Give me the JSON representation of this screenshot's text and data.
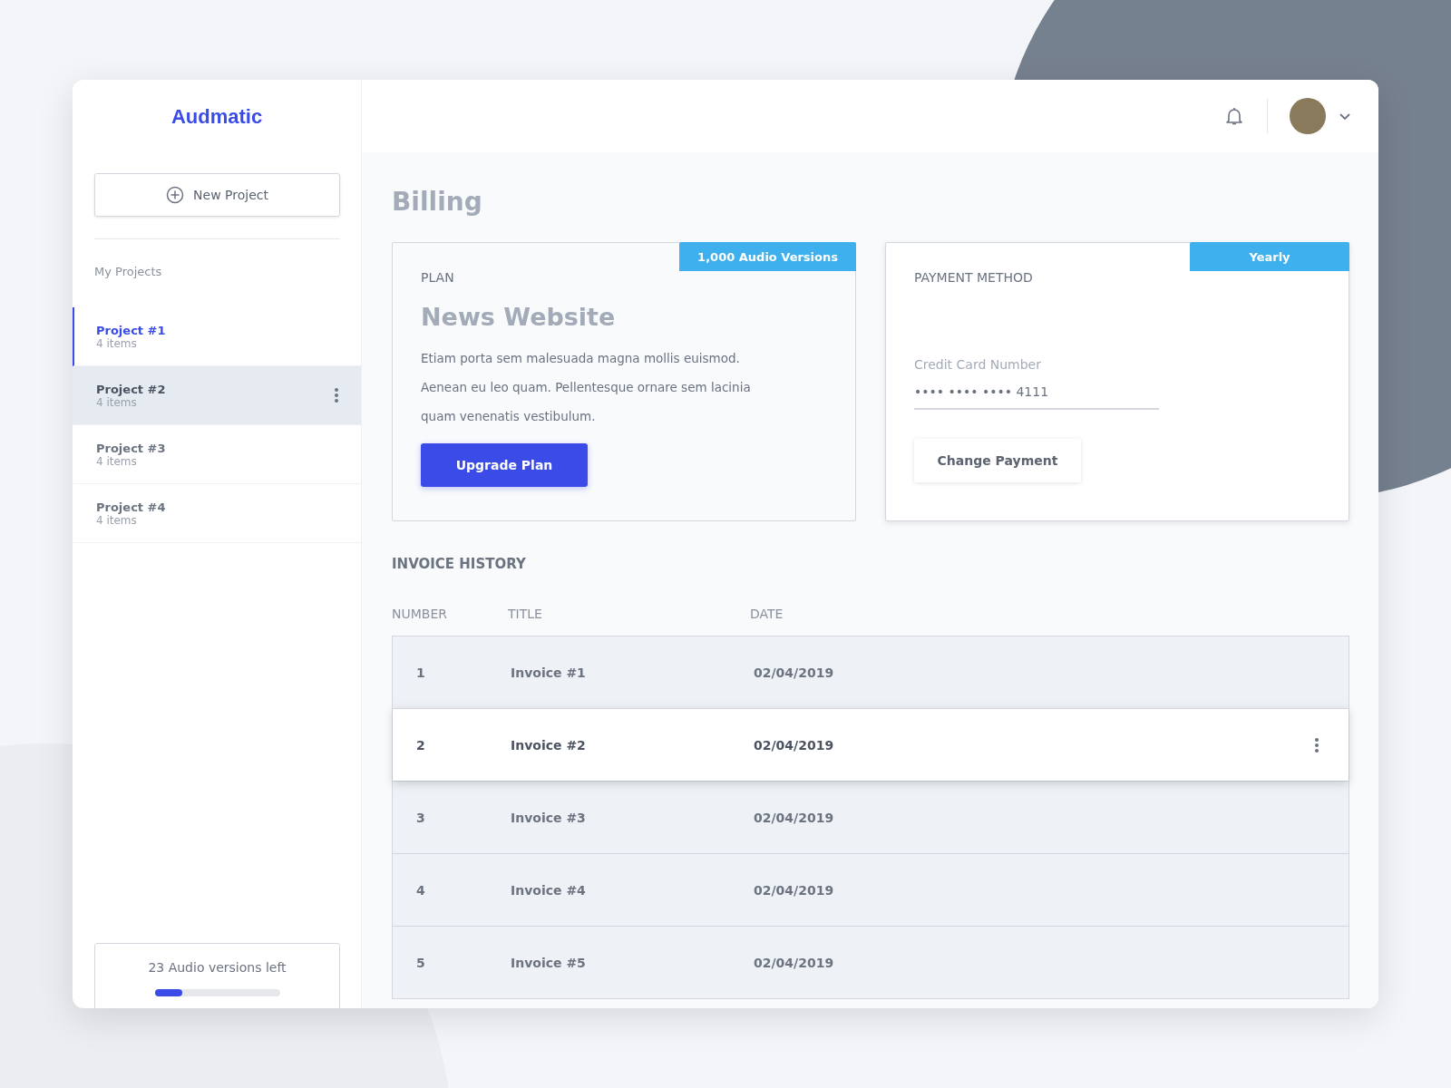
{
  "brand": "Audmatic",
  "sidebar": {
    "new_project": "New Project",
    "section_label": "My Projects",
    "projects": [
      {
        "name": "Project #1",
        "count": "4 items",
        "selected": true,
        "hovered": false
      },
      {
        "name": "Project #2",
        "count": "4 items",
        "selected": false,
        "hovered": true
      },
      {
        "name": "Project #3",
        "count": "4 items",
        "selected": false,
        "hovered": false
      },
      {
        "name": "Project #4",
        "count": "4 items",
        "selected": false,
        "hovered": false
      }
    ],
    "usage": {
      "label": "23 Audio versions left",
      "level": 0.22
    }
  },
  "page_title": "Billing",
  "plan": {
    "badge": "1,000 Audio Versions",
    "heading": "PLAN",
    "name": "News Website",
    "description": "Etiam porta sem malesuada magna mollis euismod. Aenean eu leo quam. Pellentesque ornare sem lacinia quam venenatis vestibulum.",
    "button": "Upgrade Plan"
  },
  "payment": {
    "badge": "Yearly",
    "heading": "PAYMENT METHOD",
    "field_label": "Credit Card Number",
    "field_value": "•••• •••• •••• 4111",
    "button": "Change Payment"
  },
  "invoices": {
    "heading": "INVOICE HISTORY",
    "columns": [
      "NUMBER",
      "TITLE",
      "DATE"
    ],
    "rows": [
      {
        "number": "1",
        "title": "Invoice #1",
        "date": "02/04/2019",
        "hovered": false
      },
      {
        "number": "2",
        "title": "Invoice #2",
        "date": "02/04/2019",
        "hovered": true
      },
      {
        "number": "3",
        "title": "Invoice #3",
        "date": "02/04/2019",
        "hovered": false
      },
      {
        "number": "4",
        "title": "Invoice #4",
        "date": "02/04/2019",
        "hovered": false
      },
      {
        "number": "5",
        "title": "Invoice #5",
        "date": "02/04/2019",
        "hovered": false
      }
    ]
  }
}
